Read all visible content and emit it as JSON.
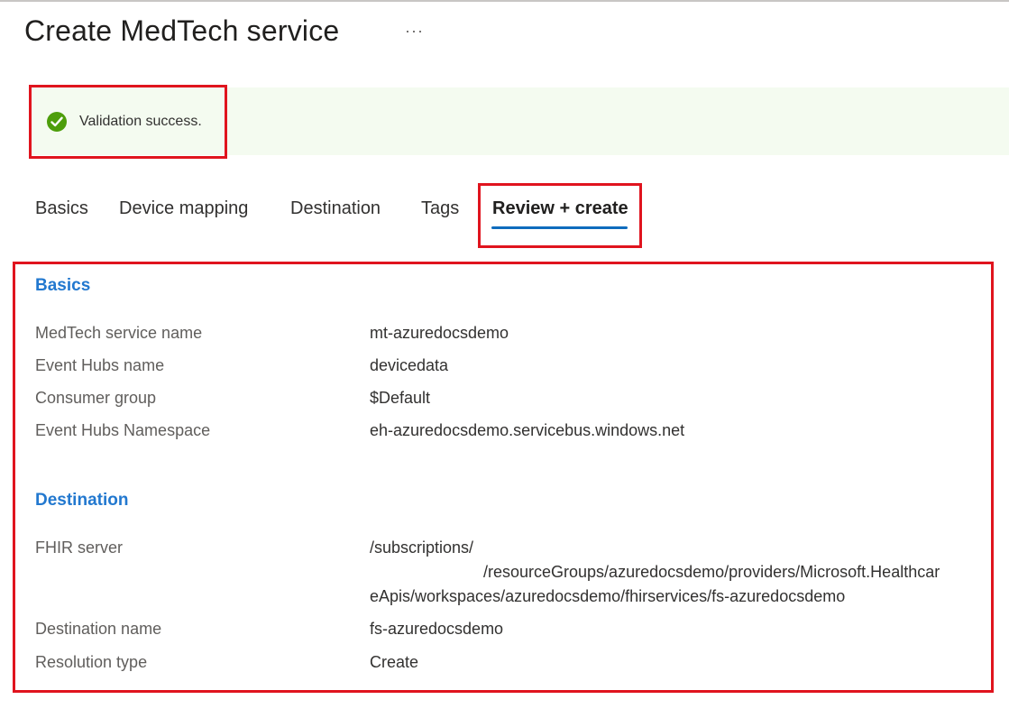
{
  "page": {
    "title": "Create MedTech service",
    "more_label": "···"
  },
  "banner": {
    "icon": "check-circle-icon",
    "message": "Validation success.",
    "color": "#4d9e0b",
    "background": "#f4fbf0"
  },
  "tabs": [
    {
      "label": "Basics",
      "active": false
    },
    {
      "label": "Device mapping",
      "active": false
    },
    {
      "label": "Destination",
      "active": false
    },
    {
      "label": "Tags",
      "active": false
    },
    {
      "label": "Review + create",
      "active": true
    }
  ],
  "review": {
    "basics": {
      "title": "Basics",
      "rows": [
        {
          "label": "MedTech service name",
          "value": "mt-azuredocsdemo"
        },
        {
          "label": "Event Hubs name",
          "value": "devicedata"
        },
        {
          "label": "Consumer group",
          "value": "$Default"
        },
        {
          "label": "Event Hubs Namespace",
          "value": "eh-azuredocsdemo.servicebus.windows.net"
        }
      ]
    },
    "destination": {
      "title": "Destination",
      "fhir_server": {
        "label": "FHIR server",
        "value_line1": "/subscriptions/",
        "value_line2": "/resourceGroups/azuredocsdemo/providers/Microsoft.Healthcar",
        "value_line3": "eApis/workspaces/azuredocsdemo/fhirservices/fs-azuredocsdemo"
      },
      "rows": [
        {
          "label": "Destination name",
          "value": "fs-azuredocsdemo"
        },
        {
          "label": "Resolution type",
          "value": "Create"
        }
      ]
    }
  },
  "colors": {
    "accent": "#0f6cbd",
    "section_title": "#2278cf",
    "highlight_box": "#e0141e"
  }
}
